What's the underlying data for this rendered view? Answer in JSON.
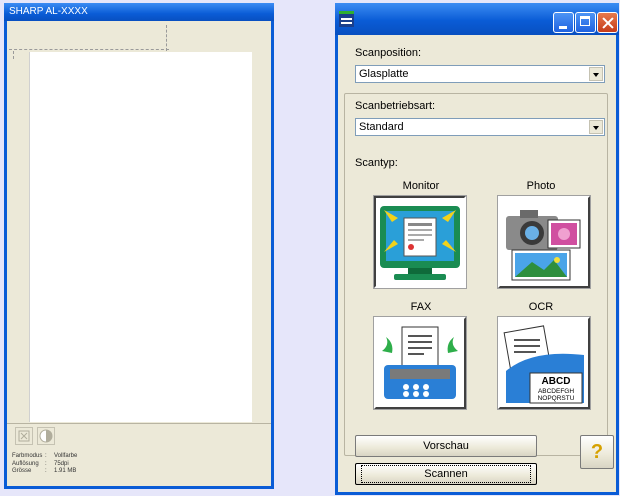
{
  "preview_window": {
    "title": "SHARP AL-XXXX",
    "info": [
      {
        "key": "Farbmodus",
        "sep": ":",
        "value": "Vollfarbe"
      },
      {
        "key": "Auflösung",
        "sep": ":",
        "value": "75dpi"
      },
      {
        "key": "Grösse",
        "sep": ":",
        "value": "1.91 MB"
      }
    ],
    "toolbar_icons": [
      "crop-icon",
      "brightness-icon"
    ]
  },
  "dialog": {
    "title": "",
    "scanposition": {
      "label": "Scanposition:",
      "value": "Glasplatte"
    },
    "scanbetriebsart": {
      "label": "Scanbetriebsart:",
      "value": "Standard"
    },
    "scantyp": {
      "label": "Scantyp:",
      "options": [
        {
          "label": "Monitor",
          "icon": "monitor-icon",
          "selected": true
        },
        {
          "label": "Photo",
          "icon": "photo-icon",
          "selected": false
        },
        {
          "label": "FAX",
          "icon": "fax-icon",
          "selected": false
        },
        {
          "label": "OCR",
          "icon": "ocr-icon",
          "selected": false
        }
      ]
    },
    "ocr_icon_text": [
      "ABCD",
      "ABCDEFGH",
      "NOPQRSTU"
    ],
    "buttons": {
      "preview": "Vorschau",
      "scan": "Scannen",
      "help": "?"
    },
    "colors": {
      "titlebar": "#0a5cd6",
      "body": "#ece9d8",
      "background": "#e6e6fa"
    }
  }
}
